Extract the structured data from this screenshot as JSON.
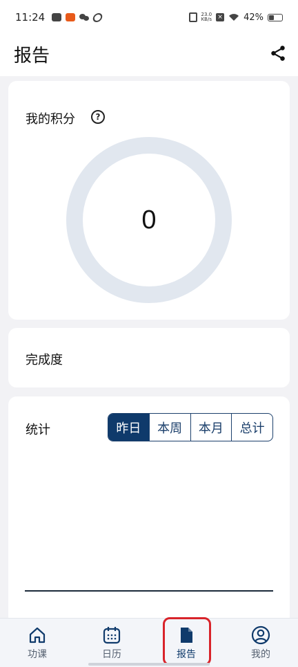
{
  "status_bar": {
    "time": "11:24",
    "speed_value": "23.0",
    "speed_unit": "KB/s",
    "battery_text": "42%",
    "battery_level": 0.42
  },
  "header": {
    "title": "报告"
  },
  "score_card": {
    "title": "我的积分",
    "value": "0"
  },
  "completion_card": {
    "title": "完成度"
  },
  "stats_card": {
    "title": "统计",
    "tabs": [
      "昨日",
      "本周",
      "本月",
      "总计"
    ],
    "active_tab": "昨日"
  },
  "bottom_nav": {
    "items": [
      {
        "label": "功课",
        "icon": "home-icon"
      },
      {
        "label": "日历",
        "icon": "calendar-icon"
      },
      {
        "label": "报告",
        "icon": "document-icon"
      },
      {
        "label": "我的",
        "icon": "user-icon"
      }
    ],
    "active_label": "报告"
  },
  "colors": {
    "accent": "#0f3a6b",
    "gauge_track": "#e1e7ef",
    "highlight": "#d8232a"
  }
}
